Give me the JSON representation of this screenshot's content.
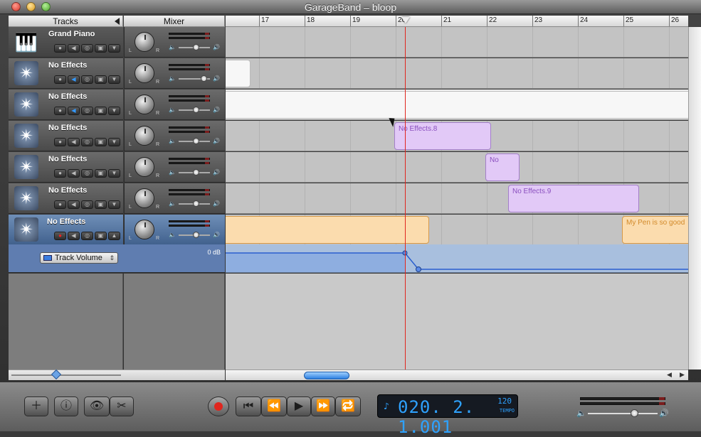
{
  "window": {
    "title": "GarageBand – bloop"
  },
  "headers": {
    "tracks": "Tracks",
    "mixer": "Mixer"
  },
  "ruler": {
    "bars": [
      "17",
      "18",
      "19",
      "20",
      "21",
      "22",
      "23",
      "24",
      "25",
      "26"
    ]
  },
  "tracks": [
    {
      "name": "Grand Piano",
      "icon": "piano-icon"
    },
    {
      "name": "No Effects",
      "icon": "star-icon"
    },
    {
      "name": "No Effects",
      "icon": "star-icon"
    },
    {
      "name": "No Effects",
      "icon": "star-icon"
    },
    {
      "name": "No Effects",
      "icon": "star-icon"
    },
    {
      "name": "No Effects",
      "icon": "star-icon"
    },
    {
      "name": "No Effects",
      "icon": "star-icon"
    }
  ],
  "regions": {
    "r4": "No Effects.8",
    "r5": "No",
    "r6": "No Effects.9",
    "r7b": "My Pen is so good"
  },
  "automation": {
    "select_label": "Track Volume",
    "db_label": "0 dB"
  },
  "transport": {
    "time": "020. 2. 1.001",
    "tempo": "120",
    "tempo_label": "TEMPO"
  },
  "colors": {
    "playhead": "#e0261e",
    "purple_region": "#e2c9f7",
    "orange_region": "#fbdcae",
    "selected_track": "#41618d",
    "lcd_text": "#2ea2ff"
  }
}
